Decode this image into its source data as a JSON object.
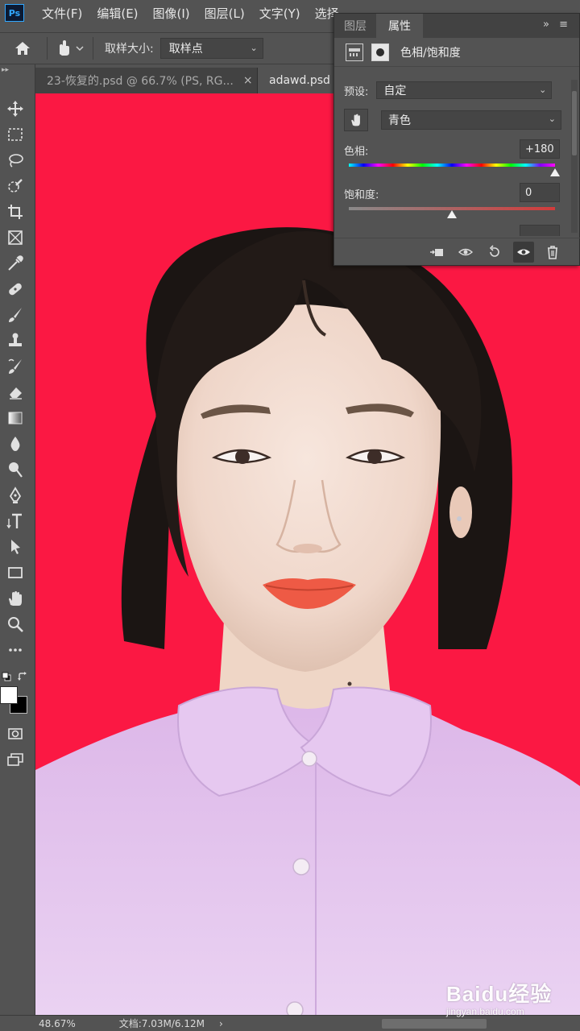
{
  "menubar": {
    "app_logo": "Ps",
    "items": [
      "文件(F)",
      "编辑(E)",
      "图像(I)",
      "图层(L)",
      "文字(Y)",
      "选择"
    ]
  },
  "options_bar": {
    "sample_size_label": "取样大小:",
    "sample_size_value": "取样点"
  },
  "tabs": [
    {
      "label": "23-恢复的.psd @ 66.7% (PS, RG...",
      "close": "×"
    },
    {
      "label": "adawd.psd",
      "close": "×"
    }
  ],
  "properties_panel": {
    "tabs": [
      "图层",
      "属性"
    ],
    "active_tab": "属性",
    "menu_icon": "»  ≡",
    "adjustment_title": "色相/饱和度",
    "preset_label": "预设:",
    "preset_value": "自定",
    "channel_value": "青色",
    "hue_label": "色相:",
    "hue_value": "+180",
    "hue_level": 1.0,
    "saturation_label": "饱和度:",
    "saturation_value": "0",
    "saturation_level": 0.5
  },
  "toolbar": {
    "tools": [
      "move-tool",
      "marquee-tool",
      "lasso-tool",
      "quick-select-tool",
      "crop-tool",
      "frame-tool",
      "eyedropper-tool",
      "healing-brush-tool",
      "brush-tool",
      "clone-stamp-tool",
      "history-brush-tool",
      "eraser-tool",
      "gradient-tool",
      "blur-tool",
      "dodge-tool",
      "pen-tool",
      "type-tool",
      "path-select-tool",
      "rectangle-tool",
      "hand-tool",
      "zoom-tool",
      "more-tools"
    ],
    "foreground_color": "#ffffff",
    "background_color": "#000000"
  },
  "canvas": {
    "background_color": "#fb1843",
    "shirt_color": "#e4c4ee"
  },
  "status_bar": {
    "zoom": "48.67%",
    "doc_info": "文档:7.03M/6.12M",
    "arrow": "›"
  },
  "watermark": {
    "logo": "Baidu经验",
    "site": "jingyan.baidu.com"
  }
}
